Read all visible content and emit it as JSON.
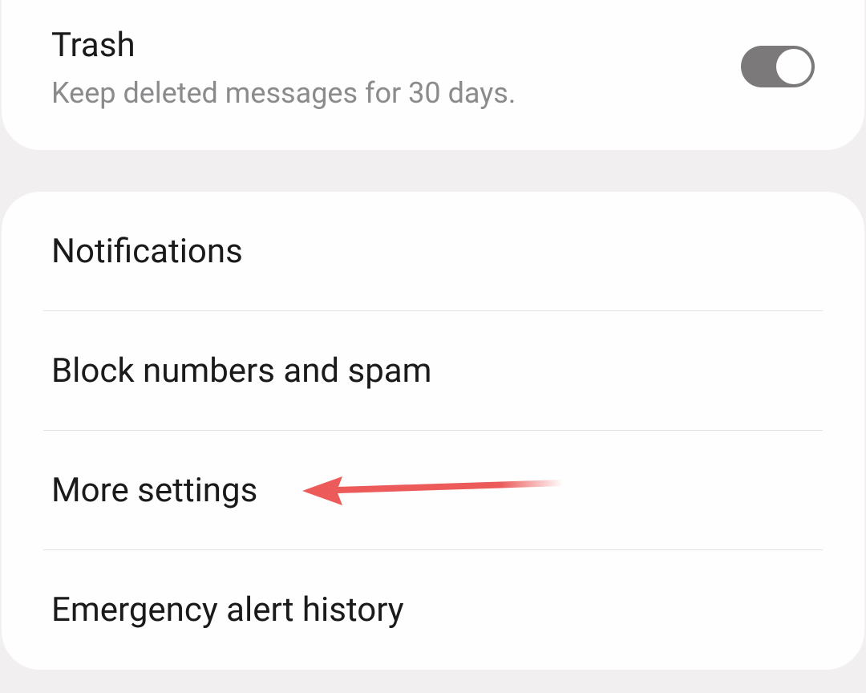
{
  "trash": {
    "title": "Trash",
    "subtitle": "Keep deleted messages for 30 days.",
    "toggle_on": true
  },
  "settings_list": {
    "items": [
      {
        "label": "Notifications"
      },
      {
        "label": "Block numbers and spam"
      },
      {
        "label": "More settings"
      },
      {
        "label": "Emergency alert history"
      }
    ]
  },
  "annotations": {
    "arrow_color": "#ec5a5a"
  }
}
